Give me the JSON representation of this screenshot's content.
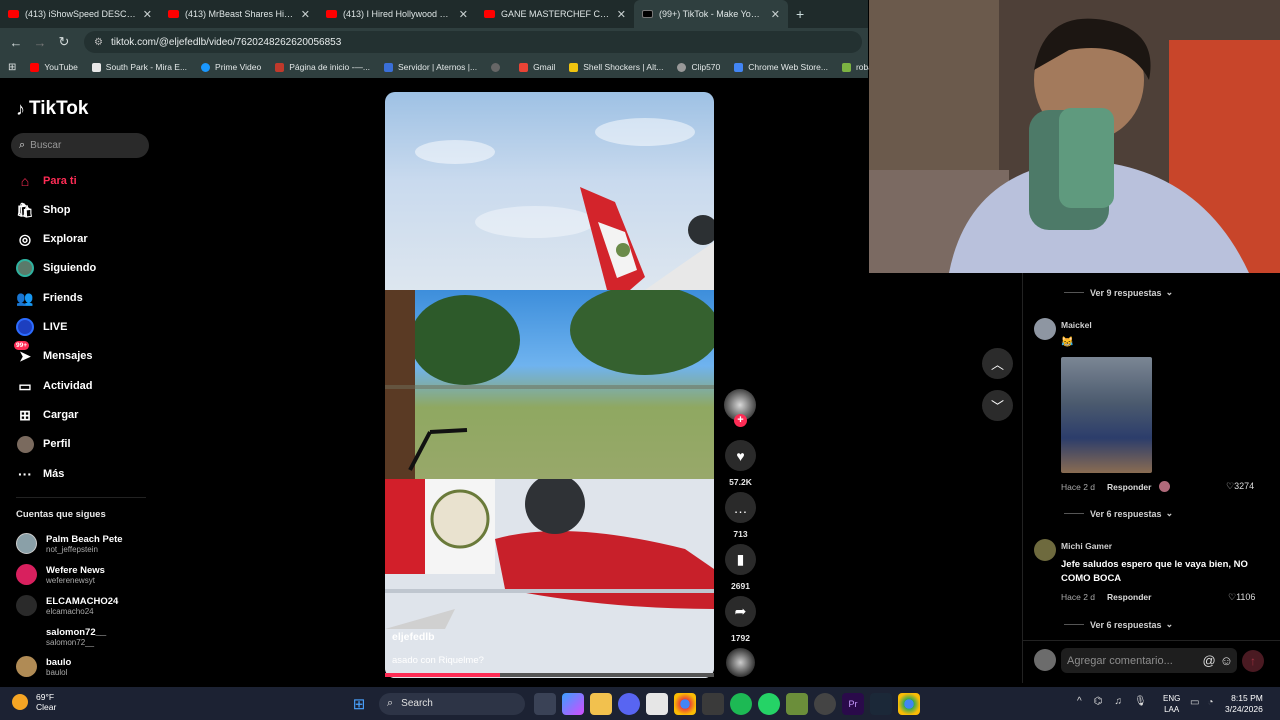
{
  "browser": {
    "tabs": [
      {
        "title": "(413) iShowSpeed DESCRIBES E",
        "icon": "youtube-icon",
        "active": false
      },
      {
        "title": "(413) MrBeast Shares His Best V",
        "icon": "youtube-icon",
        "active": false
      },
      {
        "title": "(413) I Hired Hollywood Stuntm",
        "icon": "youtube-icon",
        "active": false
      },
      {
        "title": "GANE MASTERCHEF CELEBRITY",
        "icon": "youtube-icon",
        "active": false
      },
      {
        "title": "(99+) TikTok - Make Your Da",
        "icon": "tiktok-icon",
        "active": true
      }
    ],
    "url": "tiktok.com/@eljefedlb/video/7620248262620056853",
    "bookmarks": [
      "YouTube",
      "South Park - Mira E...",
      "Prime Video",
      "Página de inicio -—...",
      "Servidor | Aternos |...",
      "Gmail",
      "Shell Shockers | Alt...",
      "Clip570",
      "Chrome Web Store...",
      "roba videos"
    ]
  },
  "sidebar": {
    "logo": "TikTok",
    "search_placeholder": "Buscar",
    "nav": [
      {
        "label": "Para ti",
        "icon": "home-icon",
        "active": true
      },
      {
        "label": "Shop",
        "icon": "shop-icon"
      },
      {
        "label": "Explorar",
        "icon": "compass-icon"
      },
      {
        "label": "Siguiendo",
        "icon": "following-avatar-icon"
      },
      {
        "label": "Friends",
        "icon": "friends-icon"
      },
      {
        "label": "LIVE",
        "icon": "live-icon"
      },
      {
        "label": "Mensajes",
        "icon": "messages-icon",
        "badge": "99+"
      },
      {
        "label": "Actividad",
        "icon": "activity-icon"
      },
      {
        "label": "Cargar",
        "icon": "upload-icon"
      },
      {
        "label": "Perfil",
        "icon": "profile-icon"
      },
      {
        "label": "Más",
        "icon": "more-icon"
      }
    ],
    "following_header": "Cuentas que sigues",
    "following": [
      {
        "name": "Palm Beach Pete",
        "handle": "not_jeffepstein"
      },
      {
        "name": "Wefere News",
        "handle": "weferenewsyt"
      },
      {
        "name": "ELCAMACHO24",
        "handle": "elcamacho24"
      },
      {
        "name": "salomon72__",
        "handle": "salomon72__"
      },
      {
        "name": "baulo",
        "handle": "baulol"
      }
    ]
  },
  "video": {
    "username": "eljefedlb",
    "caption": "asado con Riquelme?",
    "progress": 0.35,
    "likes": "57.2K",
    "comments": "713",
    "saves": "2691",
    "shares": "1792"
  },
  "comments": {
    "view_replies_1": "Ver 9 respuestas",
    "c1": {
      "user": "Maickel",
      "emoji": "😹",
      "time": "Hace 2 d",
      "reply": "Responder",
      "likes": "3274",
      "view_replies": "Ver 6 respuestas"
    },
    "c2": {
      "user": "Michi Gamer",
      "text": "Jefe saludos espero que le vaya bien, NO COMO BOCA",
      "time": "Hace 2 d",
      "reply": "Responder",
      "likes": "1106",
      "view_replies": "Ver 6 respuestas"
    },
    "input_placeholder": "Agregar comentario..."
  },
  "taskbar": {
    "temp": "69°F",
    "weather": "Clear",
    "search": "Search",
    "lang1": "ENG",
    "lang2": "LAA",
    "time": "8:15 PM",
    "date": "3/24/2026"
  },
  "colors": {
    "accent": "#fe2c55",
    "background": "#000000"
  }
}
